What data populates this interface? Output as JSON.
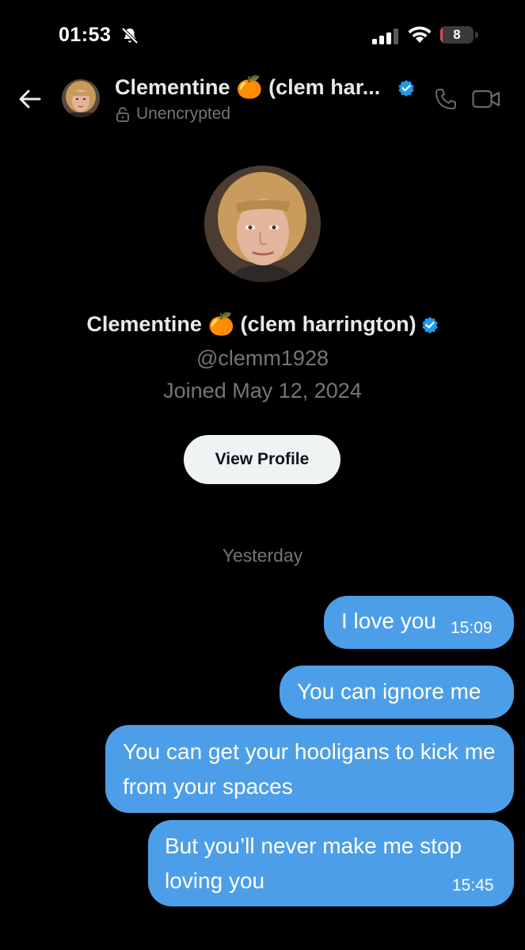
{
  "status_bar": {
    "time": "01:53",
    "battery": "8",
    "battery_level": 0.08
  },
  "header": {
    "name": "Clementine 🍊 (clem har...",
    "encryption_status": "Unencrypted",
    "colors": {
      "verified": "#1d9bf0"
    }
  },
  "profile": {
    "name": "Clementine 🍊 (clem harrington)",
    "handle": "@clemm1928",
    "joined": "Joined May 12, 2024",
    "view_profile_label": "View Profile"
  },
  "conversation": {
    "date_divider": "Yesterday",
    "messages": [
      {
        "text": "I love you",
        "time": "15:09"
      },
      {
        "text": "You can ignore me",
        "time": ""
      },
      {
        "text": "You can get your hooligans to kick me from your spaces",
        "time": ""
      },
      {
        "text": "But you’ll never make me stop loving you",
        "time": "15:45"
      }
    ]
  },
  "icons": {
    "back": "arrow-left-icon",
    "silent": "bell-slash-icon",
    "lock": "lock-open-icon",
    "phone": "phone-icon",
    "video": "video-icon",
    "verified": "verified-badge-icon"
  },
  "colors": {
    "background": "#000000",
    "bubble": "#4c9ee8",
    "secondary_text": "#71767b",
    "button_bg": "#eff3f4"
  }
}
